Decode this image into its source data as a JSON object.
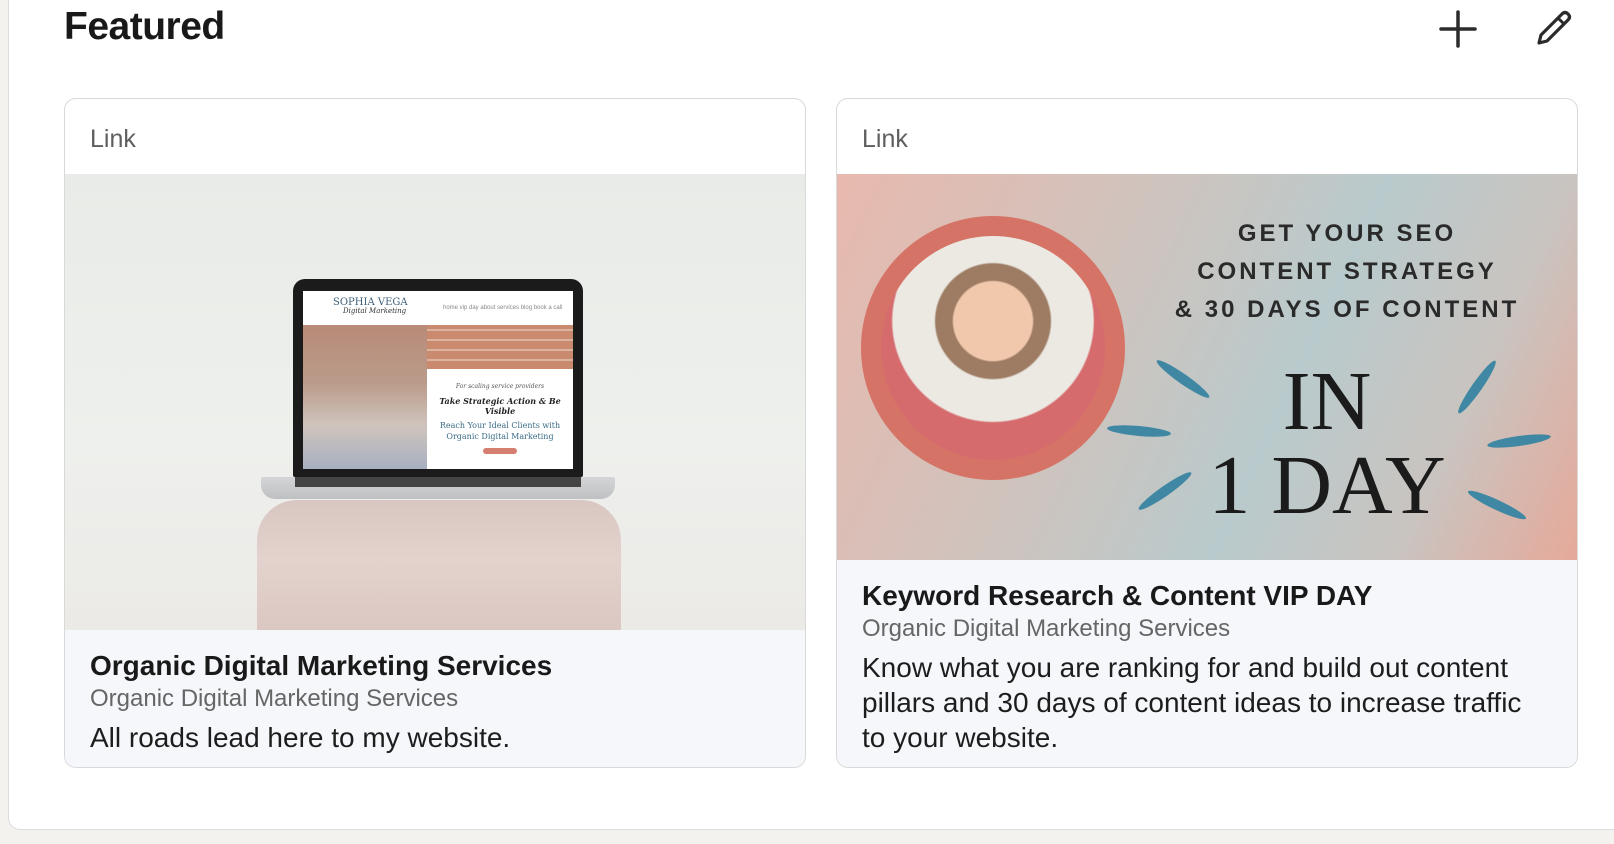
{
  "section": {
    "title": "Featured",
    "add_icon": "plus-icon",
    "edit_icon": "pencil-icon"
  },
  "cards": [
    {
      "type": "Link",
      "title": "Organic Digital Marketing Services",
      "subtitle": "Organic Digital Marketing Services",
      "description": "All roads lead here to my website.",
      "thumbnail": {
        "logo_line1": "SOPHIA VEGA",
        "logo_line2": "Digital Marketing",
        "nav": "home   vip day   about   services   blog   book a call",
        "tagline": "For scaling service providers",
        "headline": "Take Strategic Action & Be Visible",
        "subheadline": "Reach Your Ideal Clients with Organic Digital Marketing"
      }
    },
    {
      "type": "Link",
      "title": "Keyword Research & Content VIP DAY",
      "subtitle": "Organic Digital Marketing Services",
      "description": "Know what you are ranking for and build out content pillars and 30 days of content ideas to increase traffic to your website.",
      "thumbnail": {
        "line1": "GET YOUR SEO",
        "line2": "CONTENT STRATEGY",
        "line3": "& 30 DAYS OF CONTENT",
        "big1": "IN",
        "big2": "1 DAY"
      }
    }
  ],
  "colors": {
    "accent_ring": "#d57466",
    "ray": "#3f87a3"
  }
}
